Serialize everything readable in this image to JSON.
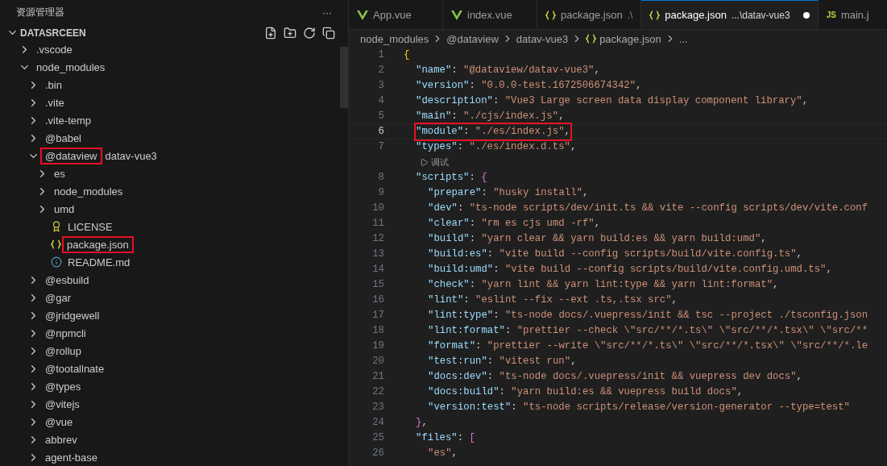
{
  "sidebar": {
    "title": "资源管理器",
    "more": "···",
    "section": {
      "title": "DATASRCEEN",
      "expanded": true
    },
    "tree": [
      {
        "label": ".vscode",
        "kind": "folder",
        "expanded": false
      },
      {
        "label": "node_modules",
        "kind": "folder",
        "expanded": true,
        "children": [
          {
            "label": ".bin",
            "kind": "folder",
            "expanded": false
          },
          {
            "label": ".vite",
            "kind": "folder",
            "expanded": false
          },
          {
            "label": ".vite-temp",
            "kind": "folder",
            "expanded": false
          },
          {
            "label": "@babel",
            "kind": "folder",
            "expanded": false
          },
          {
            "label": "@dataview",
            "compact_label": "datav-vue3",
            "kind": "folder",
            "expanded": true,
            "highlighted": true,
            "children": [
              {
                "label": "es",
                "kind": "folder",
                "expanded": false
              },
              {
                "label": "node_modules",
                "kind": "folder",
                "expanded": false
              },
              {
                "label": "umd",
                "kind": "folder",
                "expanded": false
              },
              {
                "label": "LICENSE",
                "kind": "license"
              },
              {
                "label": "package.json",
                "kind": "json",
                "highlighted": true
              },
              {
                "label": "README.md",
                "kind": "info"
              }
            ]
          },
          {
            "label": "@esbuild",
            "kind": "folder",
            "expanded": false
          },
          {
            "label": "@gar",
            "kind": "folder",
            "expanded": false
          },
          {
            "label": "@jridgewell",
            "kind": "folder",
            "expanded": false
          },
          {
            "label": "@npmcli",
            "kind": "folder",
            "expanded": false
          },
          {
            "label": "@rollup",
            "kind": "folder",
            "expanded": false
          },
          {
            "label": "@tootallnate",
            "kind": "folder",
            "expanded": false
          },
          {
            "label": "@types",
            "kind": "folder",
            "expanded": false
          },
          {
            "label": "@vitejs",
            "kind": "folder",
            "expanded": false
          },
          {
            "label": "@vue",
            "kind": "folder",
            "expanded": false
          },
          {
            "label": "abbrev",
            "kind": "folder",
            "expanded": false
          },
          {
            "label": "agent-base",
            "kind": "folder",
            "expanded": false
          }
        ]
      }
    ]
  },
  "tabs": [
    {
      "label": "App.vue",
      "kind": "vue",
      "selected": false,
      "modified": false
    },
    {
      "label": "index.vue",
      "kind": "vue",
      "selected": false,
      "modified": false
    },
    {
      "label": "package.json",
      "description": ".\\",
      "kind": "json",
      "selected": false,
      "modified": false
    },
    {
      "label": "package.json",
      "description": "...\\datav-vue3",
      "kind": "json",
      "selected": true,
      "modified": true
    },
    {
      "label": "main.j",
      "badge": "JS",
      "kind": "js",
      "selected": false,
      "modified": false
    }
  ],
  "breadcrumb": [
    {
      "label": "node_modules",
      "kind": "text"
    },
    {
      "label": "@dataview",
      "kind": "text"
    },
    {
      "label": "datav-vue3",
      "kind": "text"
    },
    {
      "label": "package.json",
      "kind": "json"
    },
    {
      "label": "...",
      "kind": "text"
    }
  ],
  "editor": {
    "lines": [
      {
        "kind": "code",
        "number": "1",
        "current": false,
        "highlighted": false,
        "tokens": [
          {
            "kind": "open",
            "text": "{"
          }
        ]
      },
      {
        "kind": "code",
        "number": "2",
        "current": false,
        "highlighted": false,
        "tokens": [
          {
            "kind": "key",
            "text": "\"name\""
          },
          {
            "kind": "punct",
            "text": ":"
          },
          {
            "kind": "string",
            "text": "\"@dataview/datav-vue3\""
          },
          {
            "kind": "punct",
            "text": ","
          }
        ]
      },
      {
        "kind": "code",
        "number": "3",
        "current": false,
        "highlighted": false,
        "tokens": [
          {
            "kind": "key",
            "text": "\"version\""
          },
          {
            "kind": "punct",
            "text": ":"
          },
          {
            "kind": "string",
            "text": "\"0.0.0-test.1672506674342\""
          },
          {
            "kind": "punct",
            "text": ","
          }
        ]
      },
      {
        "kind": "code",
        "number": "4",
        "current": false,
        "highlighted": false,
        "tokens": [
          {
            "kind": "key",
            "text": "\"description\""
          },
          {
            "kind": "punct",
            "text": ":"
          },
          {
            "kind": "string",
            "text": "\"Vue3 Large screen data display component library\""
          },
          {
            "kind": "punct",
            "text": ","
          }
        ]
      },
      {
        "kind": "code",
        "number": "5",
        "current": false,
        "highlighted": false,
        "tokens": [
          {
            "kind": "key",
            "text": "\"main\""
          },
          {
            "kind": "punct",
            "text": ":"
          },
          {
            "kind": "string",
            "text": "\"./cjs/index.js\""
          },
          {
            "kind": "punct",
            "text": ","
          }
        ]
      },
      {
        "kind": "code",
        "number": "6",
        "current": true,
        "highlighted": true,
        "tokens": [
          {
            "kind": "key",
            "text": "\"module\""
          },
          {
            "kind": "punct",
            "text": ":"
          },
          {
            "kind": "string",
            "text": "\"./es/index.js\""
          },
          {
            "kind": "punct",
            "text": ","
          }
        ]
      },
      {
        "kind": "code",
        "number": "7",
        "current": false,
        "highlighted": false,
        "tokens": [
          {
            "kind": "key",
            "text": "\"types\""
          },
          {
            "kind": "punct",
            "text": ":"
          },
          {
            "kind": "string",
            "text": "\"./es/index.d.ts\""
          },
          {
            "kind": "punct",
            "text": ","
          }
        ]
      },
      {
        "kind": "codelens",
        "text": "调试"
      },
      {
        "kind": "code",
        "number": "8",
        "current": false,
        "highlighted": false,
        "tokens": [
          {
            "kind": "key",
            "text": "\"scripts\""
          },
          {
            "kind": "punct",
            "text": ":"
          },
          {
            "kind": "open",
            "text": "{"
          }
        ]
      },
      {
        "kind": "code",
        "number": "9",
        "current": false,
        "highlighted": false,
        "tokens": [
          {
            "kind": "key",
            "text": "\"prepare\""
          },
          {
            "kind": "punct",
            "text": ":"
          },
          {
            "kind": "string",
            "text": "\"husky install\""
          },
          {
            "kind": "punct",
            "text": ","
          }
        ]
      },
      {
        "kind": "code",
        "number": "10",
        "current": false,
        "highlighted": false,
        "tokens": [
          {
            "kind": "key",
            "text": "\"dev\""
          },
          {
            "kind": "punct",
            "text": ":"
          },
          {
            "kind": "string",
            "text": "\"ts-node scripts/dev/init.ts && vite --config scripts/dev/vite.conf"
          }
        ]
      },
      {
        "kind": "code",
        "number": "11",
        "current": false,
        "highlighted": false,
        "tokens": [
          {
            "kind": "key",
            "text": "\"clear\""
          },
          {
            "kind": "punct",
            "text": ":"
          },
          {
            "kind": "string",
            "text": "\"rm es cjs umd -rf\""
          },
          {
            "kind": "punct",
            "text": ","
          }
        ]
      },
      {
        "kind": "code",
        "number": "12",
        "current": false,
        "highlighted": false,
        "tokens": [
          {
            "kind": "key",
            "text": "\"build\""
          },
          {
            "kind": "punct",
            "text": ":"
          },
          {
            "kind": "string",
            "text": "\"yarn clear && yarn build:es && yarn build:umd\""
          },
          {
            "kind": "punct",
            "text": ","
          }
        ]
      },
      {
        "kind": "code",
        "number": "13",
        "current": false,
        "highlighted": false,
        "tokens": [
          {
            "kind": "key",
            "text": "\"build:es\""
          },
          {
            "kind": "punct",
            "text": ":"
          },
          {
            "kind": "string",
            "text": "\"vite build --config scripts/build/vite.config.ts\""
          },
          {
            "kind": "punct",
            "text": ","
          }
        ]
      },
      {
        "kind": "code",
        "number": "14",
        "current": false,
        "highlighted": false,
        "tokens": [
          {
            "kind": "key",
            "text": "\"build:umd\""
          },
          {
            "kind": "punct",
            "text": ":"
          },
          {
            "kind": "string",
            "text": "\"vite build --config scripts/build/vite.config.umd.ts\""
          },
          {
            "kind": "punct",
            "text": ","
          }
        ]
      },
      {
        "kind": "code",
        "number": "15",
        "current": false,
        "highlighted": false,
        "tokens": [
          {
            "kind": "key",
            "text": "\"check\""
          },
          {
            "kind": "punct",
            "text": ":"
          },
          {
            "kind": "string",
            "text": "\"yarn lint && yarn lint:type && yarn lint:format\""
          },
          {
            "kind": "punct",
            "text": ","
          }
        ]
      },
      {
        "kind": "code",
        "number": "16",
        "current": false,
        "highlighted": false,
        "tokens": [
          {
            "kind": "key",
            "text": "\"lint\""
          },
          {
            "kind": "punct",
            "text": ":"
          },
          {
            "kind": "string",
            "text": "\"eslint --fix --ext .ts,.tsx src\""
          },
          {
            "kind": "punct",
            "text": ","
          }
        ]
      },
      {
        "kind": "code",
        "number": "17",
        "current": false,
        "highlighted": false,
        "tokens": [
          {
            "kind": "key",
            "text": "\"lint:type\""
          },
          {
            "kind": "punct",
            "text": ":"
          },
          {
            "kind": "string",
            "text": "\"ts-node docs/.vuepress/init && tsc --project ./tsconfig.json"
          }
        ]
      },
      {
        "kind": "code",
        "number": "18",
        "current": false,
        "highlighted": false,
        "tokens": [
          {
            "kind": "key",
            "text": "\"lint:format\""
          },
          {
            "kind": "punct",
            "text": ":"
          },
          {
            "kind": "string",
            "text": "\"prettier --check \\\"src/**/*.ts\\\" \\\"src/**/*.tsx\\\" \\\"src/**"
          }
        ]
      },
      {
        "kind": "code",
        "number": "19",
        "current": false,
        "highlighted": false,
        "tokens": [
          {
            "kind": "key",
            "text": "\"format\""
          },
          {
            "kind": "punct",
            "text": ":"
          },
          {
            "kind": "string",
            "text": "\"prettier --write \\\"src/**/*.ts\\\" \\\"src/**/*.tsx\\\" \\\"src/**/*.le"
          }
        ]
      },
      {
        "kind": "code",
        "number": "20",
        "current": false,
        "highlighted": false,
        "tokens": [
          {
            "kind": "key",
            "text": "\"test:run\""
          },
          {
            "kind": "punct",
            "text": ":"
          },
          {
            "kind": "string",
            "text": "\"vitest run\""
          },
          {
            "kind": "punct",
            "text": ","
          }
        ]
      },
      {
        "kind": "code",
        "number": "21",
        "current": false,
        "highlighted": false,
        "tokens": [
          {
            "kind": "key",
            "text": "\"docs:dev\""
          },
          {
            "kind": "punct",
            "text": ":"
          },
          {
            "kind": "string",
            "text": "\"ts-node docs/.vuepress/init && vuepress dev docs\""
          },
          {
            "kind": "punct",
            "text": ","
          }
        ]
      },
      {
        "kind": "code",
        "number": "22",
        "current": false,
        "highlighted": false,
        "tokens": [
          {
            "kind": "key",
            "text": "\"docs:build\""
          },
          {
            "kind": "punct",
            "text": ":"
          },
          {
            "kind": "string",
            "text": "\"yarn build:es && vuepress build docs\""
          },
          {
            "kind": "punct",
            "text": ","
          }
        ]
      },
      {
        "kind": "code",
        "number": "23",
        "current": false,
        "highlighted": false,
        "tokens": [
          {
            "kind": "key",
            "text": "\"version:test\""
          },
          {
            "kind": "punct",
            "text": ":"
          },
          {
            "kind": "string",
            "text": "\"ts-node scripts/release/version-generator --type=test\""
          }
        ]
      },
      {
        "kind": "code",
        "number": "24",
        "current": false,
        "highlighted": false,
        "tokens": [
          {
            "kind": "close",
            "text": "}"
          },
          {
            "kind": "punct",
            "text": ","
          }
        ]
      },
      {
        "kind": "code",
        "number": "25",
        "current": false,
        "highlighted": false,
        "tokens": [
          {
            "kind": "key",
            "text": "\"files\""
          },
          {
            "kind": "punct",
            "text": ":"
          },
          {
            "kind": "open",
            "text": "["
          }
        ]
      },
      {
        "kind": "code",
        "number": "26",
        "current": false,
        "highlighted": false,
        "tokens": [
          {
            "kind": "string",
            "text": "\"es\""
          },
          {
            "kind": "punct",
            "text": ","
          }
        ]
      }
    ]
  }
}
